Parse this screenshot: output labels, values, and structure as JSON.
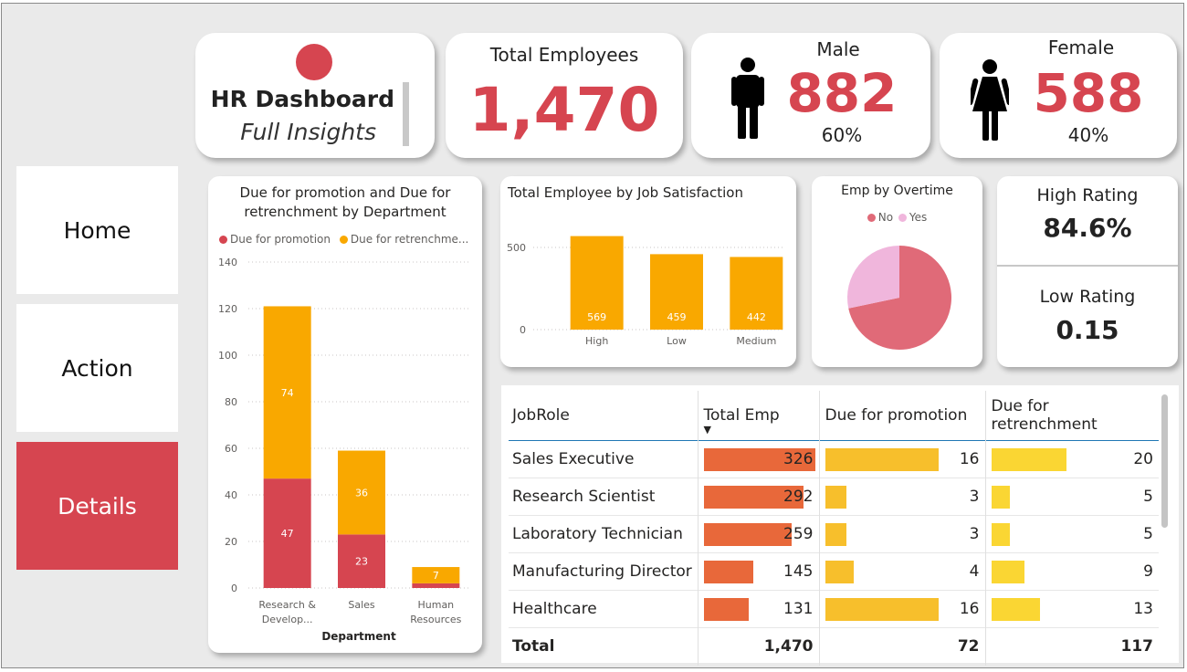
{
  "colors": {
    "accent_red": "#d64550",
    "orange": "#f9a800",
    "bar_orange_dark": "#e8683a",
    "bar_orange_mid": "#f7bf2c",
    "bar_yellow": "#fad633",
    "pie_no": "#e06a78",
    "pie_yes": "#f0b6dc"
  },
  "header": {
    "title": "HR Dashboard",
    "subtitle": "Full Insights"
  },
  "kpis": {
    "total_label": "Total Employees",
    "total_value": "1,470",
    "male_label": "Male",
    "male_value": "882",
    "male_pct": "60%",
    "female_label": "Female",
    "female_value": "588",
    "female_pct": "40%",
    "male_icon": "male-person-icon",
    "female_icon": "female-person-icon"
  },
  "nav": {
    "home": "Home",
    "action": "Action",
    "details": "Details"
  },
  "rating": {
    "high_label": "High Rating",
    "high_value": "84.6%",
    "low_label": "Low Rating",
    "low_value": "0.15"
  },
  "chart_data": [
    {
      "type": "bar",
      "stacked": true,
      "title": "Due for promotion and Due for retrenchment by Department",
      "categories": [
        "Research & Develop...",
        "Sales",
        "Human Resources"
      ],
      "series": [
        {
          "name": "Due for promotion",
          "values": [
            47,
            23,
            2
          ],
          "labels": [
            "47",
            "23",
            ""
          ]
        },
        {
          "name": "Due for retrenchme...",
          "values": [
            74,
            36,
            7
          ],
          "labels": [
            "74",
            "36",
            "7"
          ]
        }
      ],
      "xlabel": "Department",
      "ylabel": "",
      "ylim": [
        0,
        140
      ],
      "yticks": [
        0,
        20,
        40,
        60,
        80,
        100,
        120,
        140
      ],
      "grid": true,
      "legend": "top-left"
    },
    {
      "type": "bar",
      "title": "Total Employee by Job Satisfaction",
      "categories": [
        "High",
        "Low",
        "Medium"
      ],
      "values": [
        569,
        459,
        442
      ],
      "ylim": [
        0,
        600
      ],
      "yticks": [
        0,
        500
      ],
      "grid": true
    },
    {
      "type": "pie",
      "title": "Emp by Overtime",
      "labels": [
        "No",
        "Yes"
      ],
      "values": [
        1054,
        416
      ],
      "legend": "top"
    }
  ],
  "table": {
    "headers": [
      "JobRole",
      "Total Emp",
      "Due for promotion",
      "Due for retrenchment"
    ],
    "rows": [
      {
        "role": "Sales Executive",
        "total": "326",
        "promo": "16",
        "retr": "20",
        "total_n": 326,
        "promo_n": 16,
        "retr_n": 20
      },
      {
        "role": "Research Scientist",
        "total": "292",
        "promo": "3",
        "retr": "5",
        "total_n": 292,
        "promo_n": 3,
        "retr_n": 5
      },
      {
        "role": "Laboratory Technician",
        "total": "259",
        "promo": "3",
        "retr": "5",
        "total_n": 259,
        "promo_n": 3,
        "retr_n": 5
      },
      {
        "role": "Manufacturing Director",
        "total": "145",
        "promo": "4",
        "retr": "9",
        "total_n": 145,
        "promo_n": 4,
        "retr_n": 9
      },
      {
        "role": "Healthcare",
        "total": "131",
        "promo": "16",
        "retr": "13",
        "total_n": 131,
        "promo_n": 16,
        "retr_n": 13
      }
    ],
    "total_row": {
      "label": "Total",
      "total": "1,470",
      "promo": "72",
      "retr": "117"
    }
  }
}
